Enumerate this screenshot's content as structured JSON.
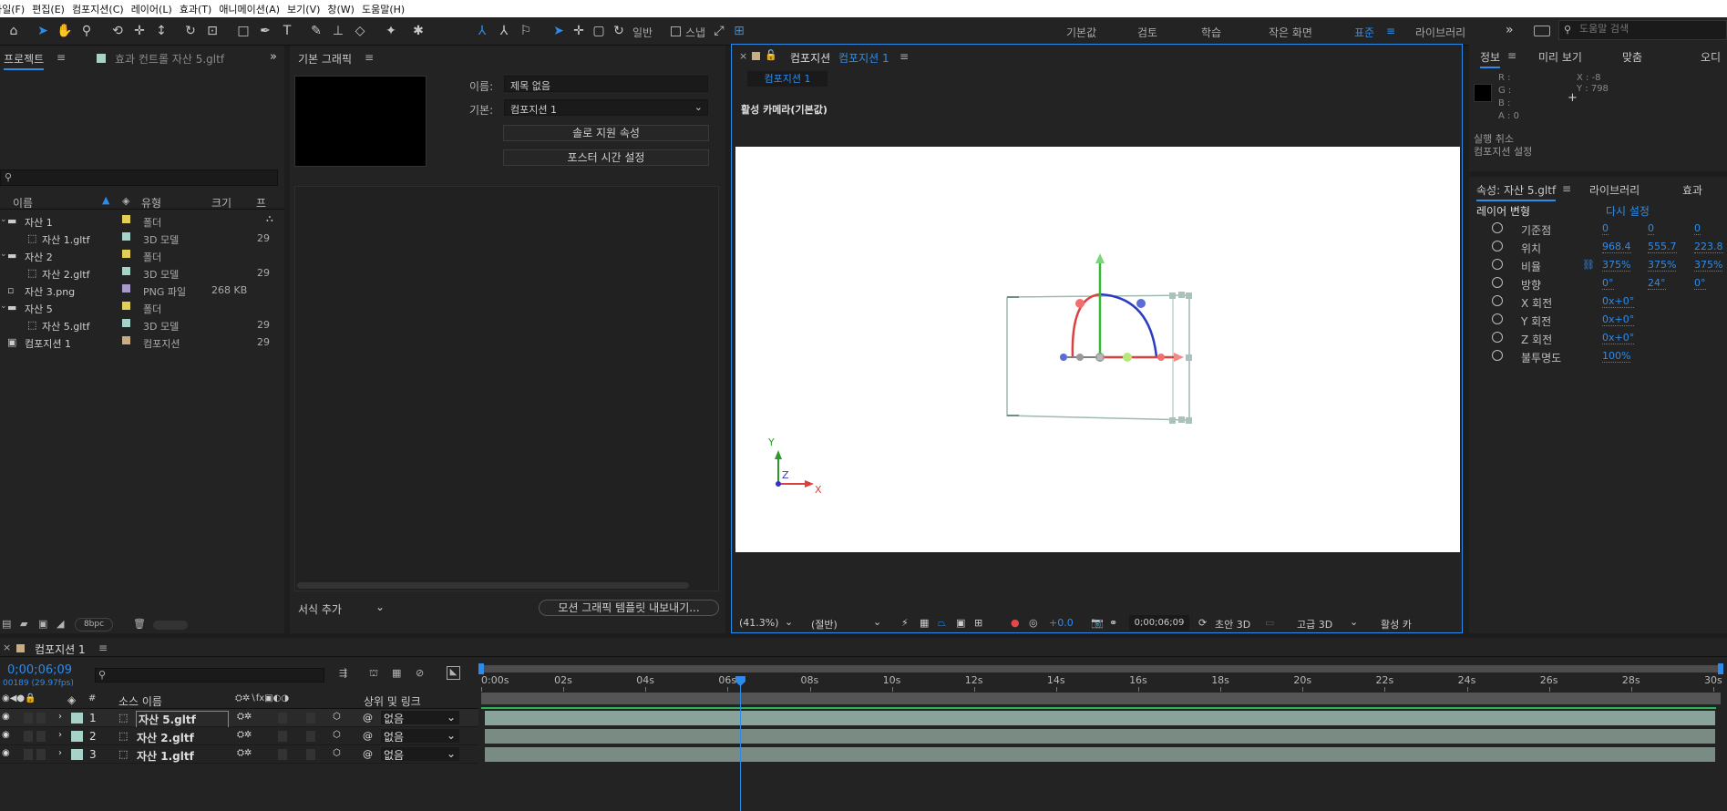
{
  "menu": [
    "파일(F)",
    "편집(E)",
    "컴포지션(C)",
    "레이어(L)",
    "효과(T)",
    "애니메이션(A)",
    "보기(V)",
    "창(W)",
    "도움말(H)"
  ],
  "toolbar": {
    "general": "일반",
    "snap": "스냅"
  },
  "workspaces": [
    {
      "label": "기본값",
      "active": false
    },
    {
      "label": "검토",
      "active": false
    },
    {
      "label": "학습",
      "active": false
    },
    {
      "label": "작은 화면",
      "active": false
    },
    {
      "label": "표준",
      "active": true
    },
    {
      "label": "라이브러리",
      "active": false
    }
  ],
  "help_search": {
    "placeholder": "도움말 검색"
  },
  "project": {
    "tab": "프로젝트",
    "effects_tab": "효과 컨트롤 자산 5.gltf",
    "columns": [
      "이름",
      "유형",
      "크기",
      "프"
    ],
    "items": [
      {
        "name": "자산 1",
        "type": "폴더",
        "size": "",
        "fr": "",
        "color": "#e3cf57",
        "indent": 0,
        "kind": "folder"
      },
      {
        "name": "자산 1.gltf",
        "type": "3D 모델",
        "size": "",
        "fr": "29",
        "color": "#a6d3c8",
        "indent": 1,
        "kind": "model"
      },
      {
        "name": "자산 2",
        "type": "폴더",
        "size": "",
        "fr": "",
        "color": "#e3cf57",
        "indent": 0,
        "kind": "folder"
      },
      {
        "name": "자산 2.gltf",
        "type": "3D 모델",
        "size": "",
        "fr": "29",
        "color": "#a6d3c8",
        "indent": 1,
        "kind": "model"
      },
      {
        "name": "자산 3.png",
        "type": "PNG 파일",
        "size": "268 KB",
        "fr": "",
        "color": "#a89ac8",
        "indent": 0,
        "kind": "png"
      },
      {
        "name": "자산 5",
        "type": "폴더",
        "size": "",
        "fr": "",
        "color": "#e3cf57",
        "indent": 0,
        "kind": "folder"
      },
      {
        "name": "자산 5.gltf",
        "type": "3D 모델",
        "size": "",
        "fr": "29",
        "color": "#a6d3c8",
        "indent": 1,
        "kind": "model"
      },
      {
        "name": "컴포지션 1",
        "type": "컴포지션",
        "size": "",
        "fr": "29",
        "color": "#c8ac84",
        "indent": 0,
        "kind": "comp"
      }
    ],
    "bpc": "8bpc"
  },
  "essential": {
    "tab": "기본 그래픽",
    "name_label": "이름:",
    "name_value": "제목 없음",
    "base_label": "기본:",
    "base_value": "컴포지션 1",
    "solo_btn": "솔로 지원 속성",
    "poster_btn": "포스터 시간 설정",
    "format": "서식 추가",
    "export_btn": "모션 그래픽 템플릿 내보내기..."
  },
  "comp": {
    "tab_prefix": "컴포지션",
    "tab_name": "컴포지션 1",
    "subtab": "컴포지션 1",
    "camera": "활성 카메라(기본값)",
    "axes": {
      "x": "X",
      "y": "Y",
      "z": "Z"
    },
    "zoom": "(41.3%)",
    "resolution": "(절반)",
    "exposure": "+0.0",
    "timecode": "0;00;06;09",
    "draft": "초안 3D",
    "quality": "고급 3D",
    "active": "활성 카"
  },
  "info": {
    "tabs": [
      "정보",
      "미리 보기",
      "맞춤",
      "오디"
    ],
    "r": "R :",
    "g": "G :",
    "b": "B :",
    "a": "A : 0",
    "x": "X : -8",
    "y": "Y : 798",
    "undo": "실행 취소",
    "undo_detail": "컴포지션 설정"
  },
  "props": {
    "tabs": [
      "속성: 자산 5.gltf",
      "라이브러리",
      "효과"
    ],
    "section": "레이어 변형",
    "reset": "다시 설정",
    "rows": [
      {
        "label": "기준점",
        "v1": "0",
        "v2": "0",
        "v3": "0"
      },
      {
        "label": "위치",
        "v1": "968.4",
        "v2": "555.7",
        "v3": "223.8"
      },
      {
        "label": "비율",
        "v1": "375%",
        "v2": "375%",
        "v3": "375%"
      },
      {
        "label": "방향",
        "v1": "0°",
        "v2": "24°",
        "v3": "0°"
      },
      {
        "label": "X 회전",
        "v1": "0x+0°",
        "v2": "",
        "v3": ""
      },
      {
        "label": "Y 회전",
        "v1": "0x+0°",
        "v2": "",
        "v3": ""
      },
      {
        "label": "Z 회전",
        "v1": "0x+0°",
        "v2": "",
        "v3": ""
      },
      {
        "label": "불투명도",
        "v1": "100%",
        "v2": "",
        "v3": ""
      }
    ]
  },
  "timeline": {
    "tab": "컴포지션 1",
    "timecode": "0;00;06;09",
    "fps": "00189 (29.97fps)",
    "col_num": "#",
    "col_source": "소스 이름",
    "col_parent": "상위 및 링크",
    "layers": [
      {
        "num": "1",
        "name": "자산 5.gltf",
        "parent": "없음"
      },
      {
        "num": "2",
        "name": "자산 2.gltf",
        "parent": "없음"
      },
      {
        "num": "3",
        "name": "자산 1.gltf",
        "parent": "없음"
      }
    ],
    "ruler": [
      "0:00s",
      "02s",
      "04s",
      "06s",
      "08s",
      "10s",
      "12s",
      "14s",
      "16s",
      "18s",
      "20s",
      "22s",
      "24s",
      "26s",
      "28s",
      "30s"
    ],
    "playhead_seconds": 6.3,
    "duration_seconds": 30
  }
}
